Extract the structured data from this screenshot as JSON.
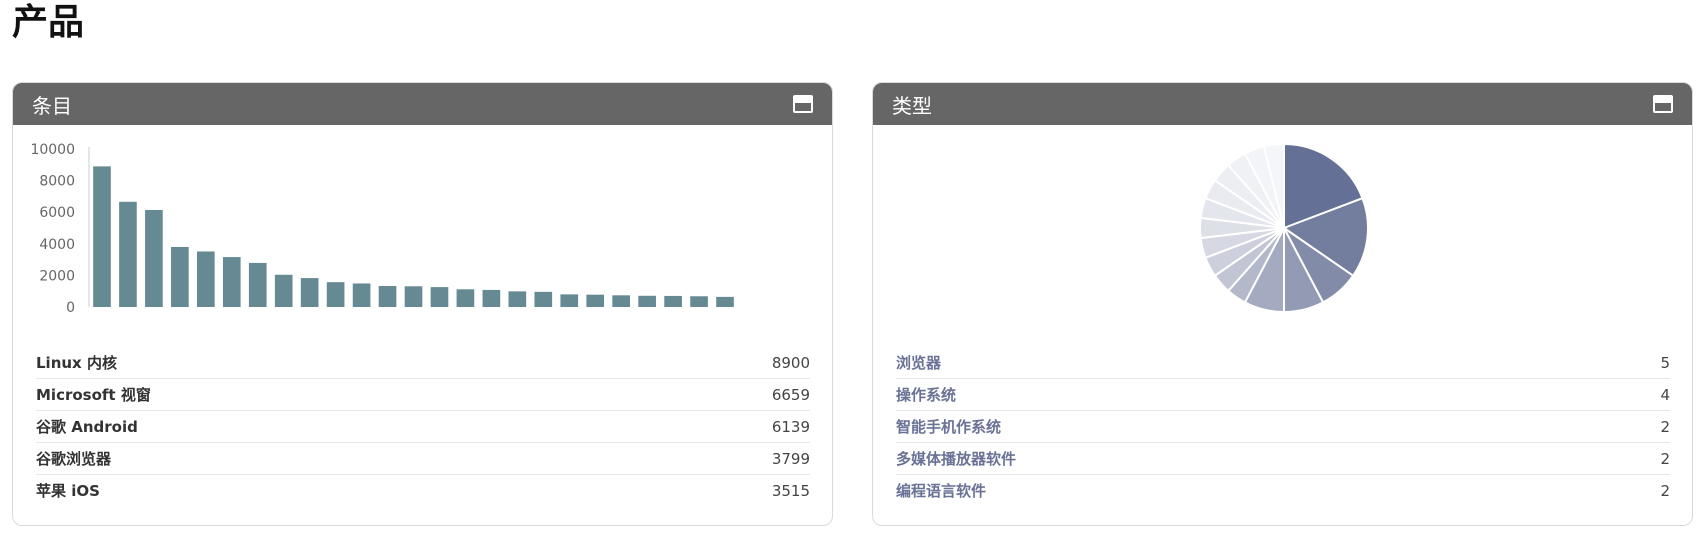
{
  "page": {
    "title": "产品"
  },
  "panels": {
    "items": {
      "title": "条目",
      "toggle_icon": "window-minimize-icon",
      "list": [
        {
          "name": "Linux 内核",
          "value": "8900"
        },
        {
          "name": "Microsoft 视窗",
          "value": "6659"
        },
        {
          "name": "谷歌 Android",
          "value": "6139"
        },
        {
          "name": "谷歌浏览器",
          "value": "3799"
        },
        {
          "name": "苹果 iOS",
          "value": "3515"
        }
      ]
    },
    "types": {
      "title": "类型",
      "toggle_icon": "window-minimize-icon",
      "list": [
        {
          "name": "浏览器",
          "value": "5"
        },
        {
          "name": "操作系统",
          "value": "4"
        },
        {
          "name": "智能手机作系统",
          "value": "2"
        },
        {
          "name": "多媒体播放器软件",
          "value": "2"
        },
        {
          "name": "编程语言软件",
          "value": "2"
        }
      ]
    }
  },
  "chart_data": [
    {
      "type": "bar",
      "values": [
        8900,
        6659,
        6139,
        3799,
        3515,
        3160,
        2790,
        2040,
        1830,
        1570,
        1490,
        1330,
        1310,
        1260,
        1120,
        1080,
        990,
        960,
        800,
        780,
        740,
        710,
        700,
        680,
        640
      ],
      "yticks": [
        "10000",
        "8000",
        "6000",
        "4000",
        "2000",
        "0"
      ],
      "ylim": [
        0,
        10000
      ],
      "color": "#668a94"
    },
    {
      "type": "pie",
      "values": [
        5,
        4,
        2,
        2,
        2,
        1,
        1,
        1,
        1,
        1,
        1,
        1,
        1,
        1,
        1,
        1
      ],
      "colors": [
        "#647095",
        "#737d9e",
        "#828ba8",
        "#939ab3",
        "#a4aabf",
        "#b3b8ca",
        "#c1c5d4",
        "#cdd0dc",
        "#d6d9e3",
        "#dee0e8",
        "#e4e6ed",
        "#e9ebf0",
        "#edeef3",
        "#f0f1f5",
        "#f3f4f7",
        "#f5f6f9"
      ]
    }
  ]
}
